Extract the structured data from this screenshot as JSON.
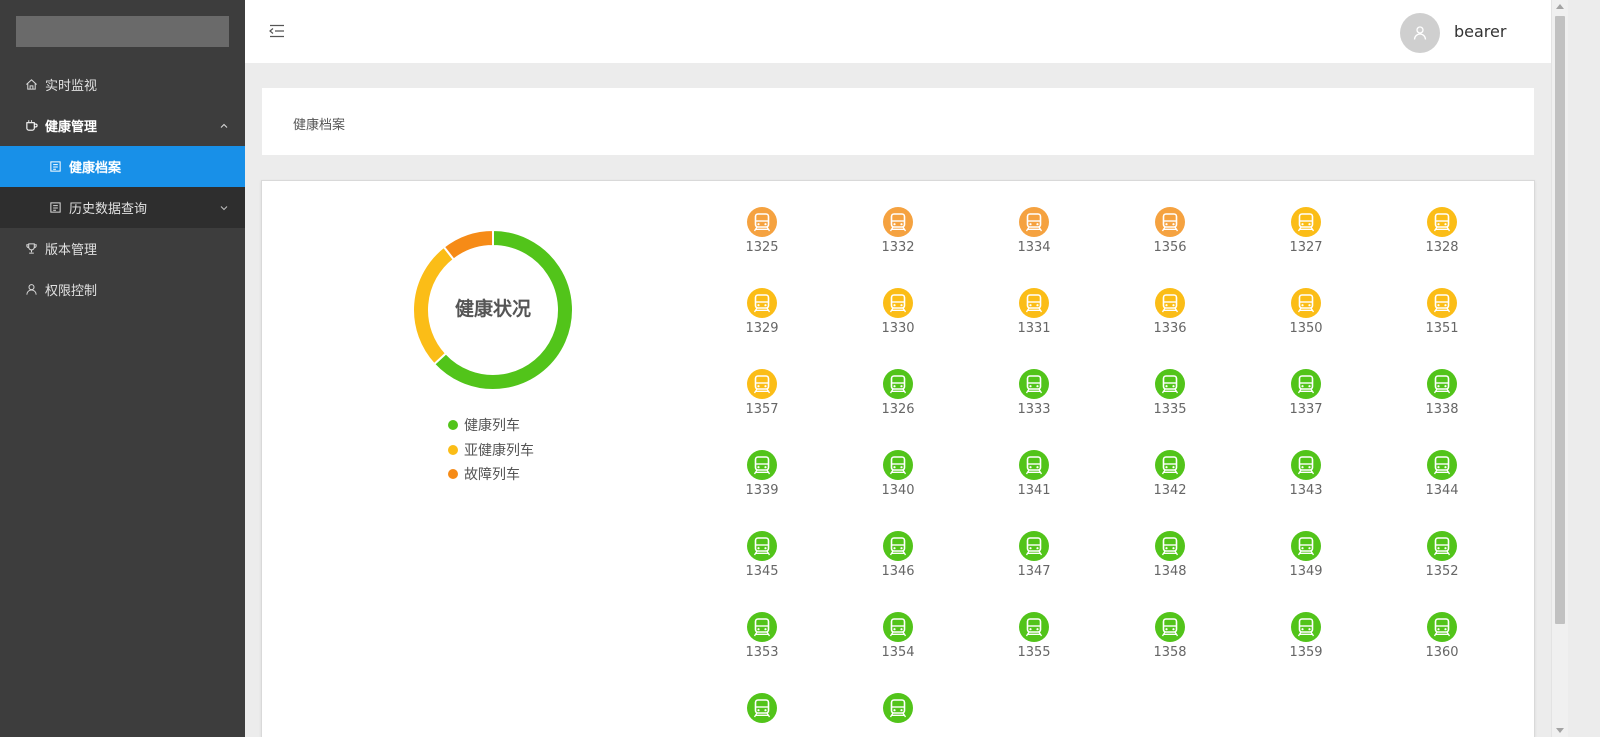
{
  "user": {
    "name": "bearer"
  },
  "sidebar": {
    "items": [
      {
        "label": "实时监视"
      },
      {
        "label": "健康管理"
      },
      {
        "label": "健康档案"
      },
      {
        "label": "历史数据查询"
      },
      {
        "label": "版本管理"
      },
      {
        "label": "权限控制"
      }
    ]
  },
  "breadcrumb": {
    "current": "健康档案"
  },
  "chart": {
    "title": "健康状况",
    "legend": [
      "健康列车",
      "亚健康列车",
      "故障列车"
    ]
  },
  "colors": {
    "healthy": "#52c41a",
    "subhealthy": "#fbbd17",
    "fault": "#f68b17",
    "fault_icon": "#f5a240",
    "active_menu": "#1890e8"
  },
  "chart_data": {
    "type": "pie",
    "title": "健康状况",
    "categories": [
      "健康列车",
      "亚健康列车",
      "故障列车"
    ],
    "values": [
      24,
      10,
      4
    ]
  },
  "trains": [
    {
      "id": "1325",
      "status": "fault"
    },
    {
      "id": "1332",
      "status": "fault"
    },
    {
      "id": "1334",
      "status": "fault"
    },
    {
      "id": "1356",
      "status": "fault"
    },
    {
      "id": "1327",
      "status": "subhealthy"
    },
    {
      "id": "1328",
      "status": "subhealthy"
    },
    {
      "id": "1329",
      "status": "subhealthy"
    },
    {
      "id": "1330",
      "status": "subhealthy"
    },
    {
      "id": "1331",
      "status": "subhealthy"
    },
    {
      "id": "1336",
      "status": "subhealthy"
    },
    {
      "id": "1350",
      "status": "subhealthy"
    },
    {
      "id": "1351",
      "status": "subhealthy"
    },
    {
      "id": "1357",
      "status": "subhealthy"
    },
    {
      "id": "1326",
      "status": "healthy"
    },
    {
      "id": "1333",
      "status": "healthy"
    },
    {
      "id": "1335",
      "status": "healthy"
    },
    {
      "id": "1337",
      "status": "healthy"
    },
    {
      "id": "1338",
      "status": "healthy"
    },
    {
      "id": "1339",
      "status": "healthy"
    },
    {
      "id": "1340",
      "status": "healthy"
    },
    {
      "id": "1341",
      "status": "healthy"
    },
    {
      "id": "1342",
      "status": "healthy"
    },
    {
      "id": "1343",
      "status": "healthy"
    },
    {
      "id": "1344",
      "status": "healthy"
    },
    {
      "id": "1345",
      "status": "healthy"
    },
    {
      "id": "1346",
      "status": "healthy"
    },
    {
      "id": "1347",
      "status": "healthy"
    },
    {
      "id": "1348",
      "status": "healthy"
    },
    {
      "id": "1349",
      "status": "healthy"
    },
    {
      "id": "1352",
      "status": "healthy"
    },
    {
      "id": "1353",
      "status": "healthy"
    },
    {
      "id": "1354",
      "status": "healthy"
    },
    {
      "id": "1355",
      "status": "healthy"
    },
    {
      "id": "1358",
      "status": "healthy"
    },
    {
      "id": "1359",
      "status": "healthy"
    },
    {
      "id": "1360",
      "status": "healthy"
    },
    {
      "id": "",
      "status": "healthy"
    },
    {
      "id": "",
      "status": "healthy"
    }
  ]
}
